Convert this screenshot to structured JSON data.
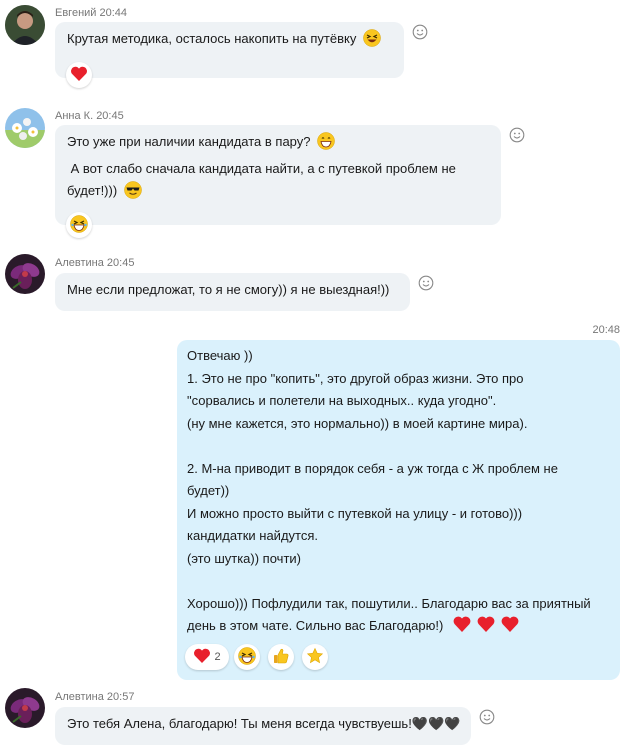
{
  "messages": [
    {
      "author": "Евгений",
      "time": "20:44",
      "lines": [
        "Крутая методика, осталось накопить на путёвку"
      ],
      "reactions": [
        {
          "icon": "heart-icon",
          "count": ""
        }
      ]
    },
    {
      "author": "Анна К.",
      "time": "20:45",
      "lines": [
        "Это уже при наличии кандидата в пару?",
        " А вот слабо сначала кандидата найти, а с путевкой проблем не",
        "будет!)))"
      ],
      "reactions": [
        {
          "icon": "laughing-face-icon",
          "count": ""
        }
      ]
    },
    {
      "author": "Алевтина",
      "time": "20:45",
      "lines": [
        "Мне если предложат, то я не смогу)) я не выездная!))"
      ],
      "reactions": []
    },
    {
      "author": "",
      "time": "20:48",
      "own": true,
      "lines": [
        "Отвечаю ))",
        "1. Это не про \"копить\", это другой образ жизни. Это про",
        "\"сорвались и полетели на выходных.. куда угодно\".",
        "(ну мне кажется, это нормально)) в моей картине мира).",
        "",
        "2. М-на приводит в порядок себя - а уж тогда с Ж проблем не",
        "будет))",
        "И можно просто выйти с путевкой на улицу - и готово)))",
        "кандидатки найдутся.",
        "(это шутка)) почти)",
        "",
        "Хорошо))) Пофлудили так, пошутили.. Благодарю вас за приятный",
        "день в этом чате. Сильно вас Благодарю!)"
      ],
      "reactions": [
        {
          "icon": "heart-icon",
          "count": "2"
        },
        {
          "icon": "laughing-face-icon",
          "count": ""
        },
        {
          "icon": "thumbs-up-icon",
          "count": ""
        },
        {
          "icon": "star-icon",
          "count": ""
        }
      ]
    },
    {
      "author": "Алевтина",
      "time": "20:57",
      "lines": [
        "Это тебя Алена, благодарю! Ты меня всегда чувствуешь!🖤🖤🖤"
      ],
      "reactions": []
    }
  ],
  "colors": {
    "incoming_bubble": "#eef2f5",
    "outgoing_bubble": "#daf1fc",
    "heart": "#e8202c",
    "meta_text": "#777777"
  }
}
